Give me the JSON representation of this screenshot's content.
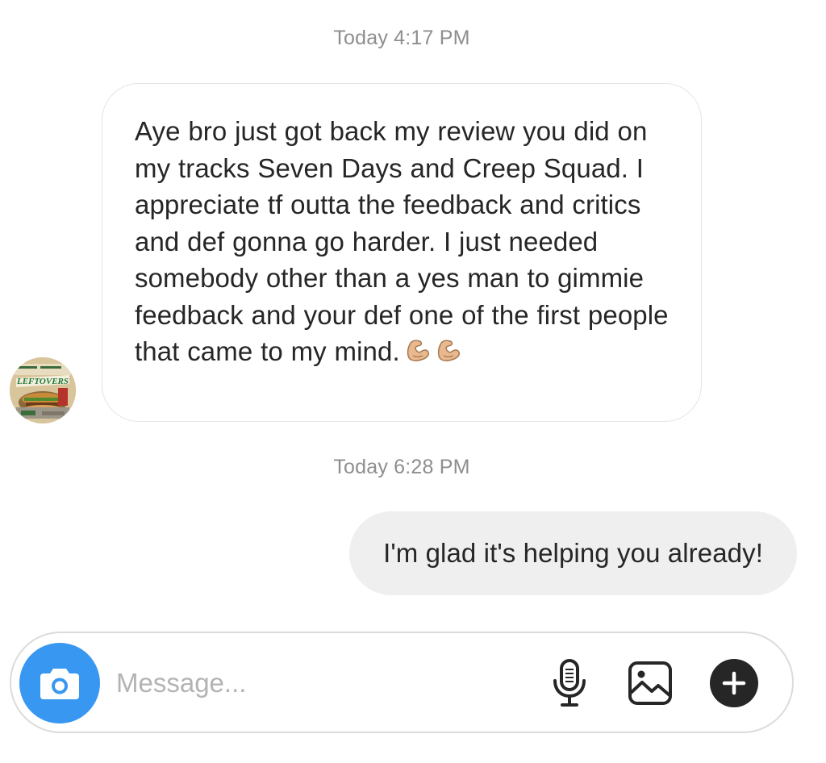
{
  "thread": {
    "timestamps": [
      "Today 4:17 PM",
      "Today 6:28 PM"
    ],
    "incoming_message": {
      "text": "Aye bro just got back my review you did on my tracks Seven Days and Creep Squad. I appreciate tf outta the feedback and critics and def gonna go harder. I just needed somebody other than a yes man to gimmie feedback and your def one of the first people that came to my mind.",
      "emoji": [
        "flexed-biceps",
        "flexed-biceps"
      ]
    },
    "outgoing_message": {
      "text": "I'm glad it's helping you already!"
    },
    "avatar": {
      "caption": "LEFTOVERS"
    }
  },
  "composer": {
    "placeholder": "Message...",
    "icons": [
      "camera-icon",
      "microphone-icon",
      "gallery-icon",
      "plus-icon"
    ],
    "accent_color": "#3897f0"
  },
  "colors": {
    "text": "#262626",
    "timestamp": "#8e8e8e",
    "outgoing_bubble": "#efefef",
    "incoming_border": "#e4e4e4"
  }
}
